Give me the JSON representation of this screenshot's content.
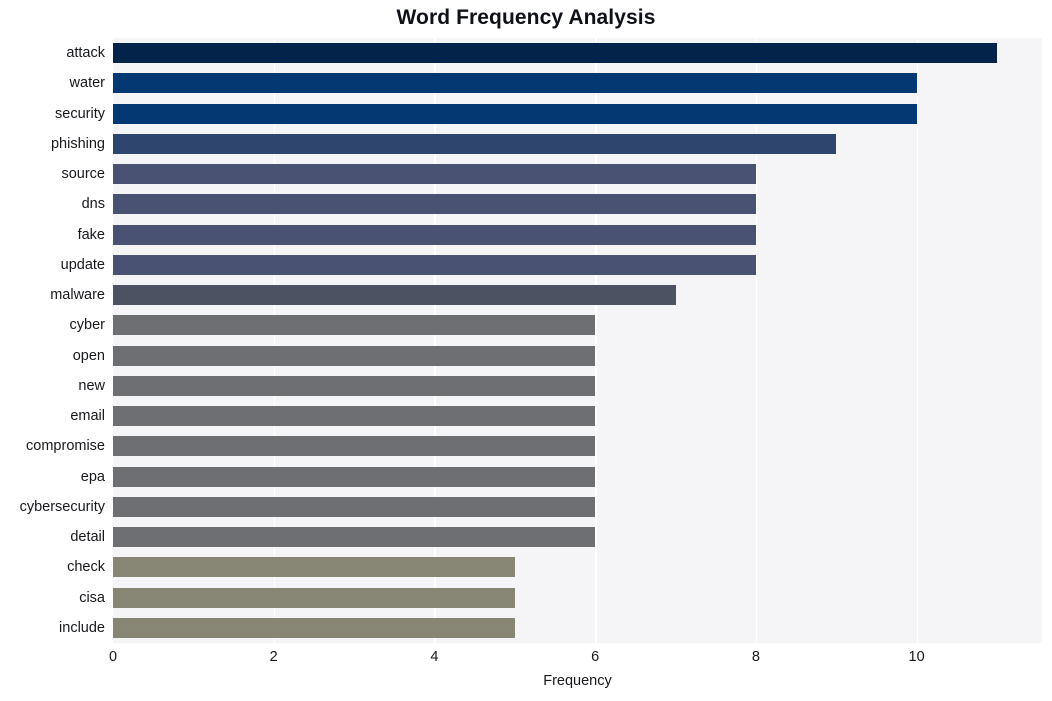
{
  "chart_data": {
    "type": "bar",
    "orientation": "horizontal",
    "title": "Word Frequency Analysis",
    "xlabel": "Frequency",
    "ylabel": "",
    "categories": [
      "attack",
      "water",
      "security",
      "phishing",
      "source",
      "dns",
      "fake",
      "update",
      "malware",
      "cyber",
      "open",
      "new",
      "email",
      "compromise",
      "epa",
      "cybersecurity",
      "detail",
      "check",
      "cisa",
      "include"
    ],
    "values": [
      11,
      10,
      10,
      9,
      8,
      8,
      8,
      8,
      7,
      6,
      6,
      6,
      6,
      6,
      6,
      6,
      6,
      5,
      5,
      5
    ],
    "bar_colors": [
      "#03234b",
      "#033872",
      "#033872",
      "#2e456e",
      "#4a5273",
      "#4a5273",
      "#4a5273",
      "#4a5273",
      "#4d5263",
      "#6e6f73",
      "#6e6f73",
      "#6e6f73",
      "#6e6f73",
      "#6e6f73",
      "#6e6f73",
      "#6e6f73",
      "#6e6f73",
      "#878573",
      "#878573",
      "#878573"
    ],
    "xlim": [
      0,
      11.56
    ],
    "xticks": [
      0,
      2,
      4,
      6,
      8,
      10
    ],
    "xticklabels": [
      "0",
      "2",
      "4",
      "6",
      "8",
      "10"
    ],
    "grid": "vertical-only",
    "legend": null,
    "plot_background": "#f5f5f7",
    "figure_background": "#ffffff",
    "title_color": "#0e1117",
    "tick_label_color": "#16181c"
  }
}
